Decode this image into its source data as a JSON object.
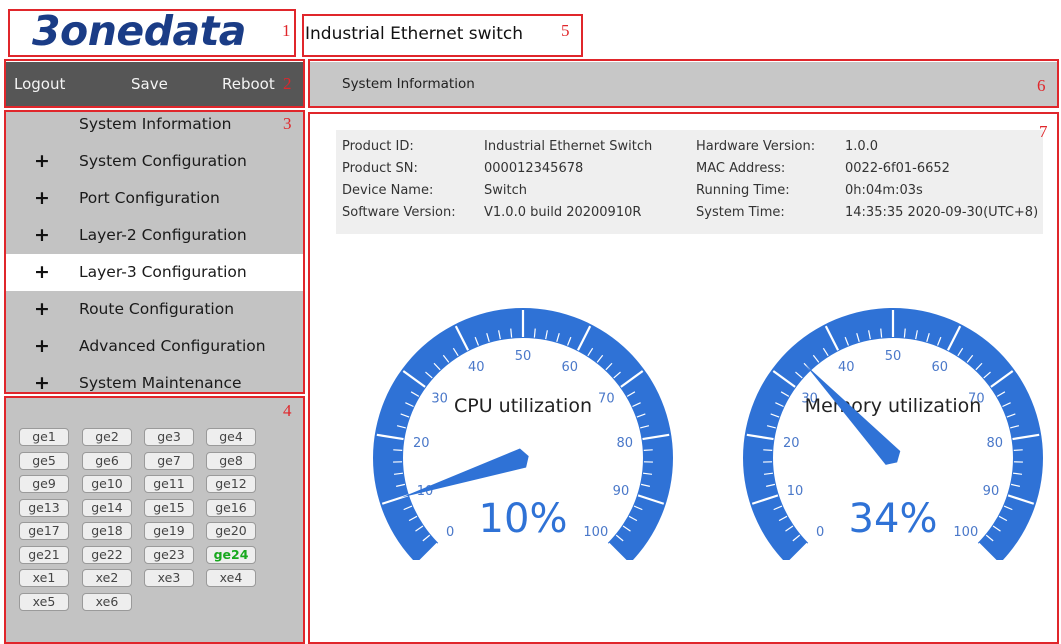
{
  "header": {
    "logo_text": "3onedata",
    "device_title": "Industrial Ethernet switch"
  },
  "topbar": {
    "logout": "Logout",
    "save": "Save",
    "reboot": "Reboot"
  },
  "breadcrumb": "System Information",
  "menu": [
    {
      "label": "System Information",
      "plus": false,
      "active": false
    },
    {
      "label": "System Configuration",
      "plus": true,
      "active": false
    },
    {
      "label": "Port Configuration",
      "plus": true,
      "active": false
    },
    {
      "label": "Layer-2 Configuration",
      "plus": true,
      "active": false
    },
    {
      "label": "Layer-3 Configuration",
      "plus": true,
      "active": true
    },
    {
      "label": "Route Configuration",
      "plus": true,
      "active": false
    },
    {
      "label": "Advanced Configuration",
      "plus": true,
      "active": false
    },
    {
      "label": "System Maintenance",
      "plus": true,
      "active": false
    }
  ],
  "plus_glyph": "+",
  "ports": [
    {
      "name": "ge1",
      "up": false
    },
    {
      "name": "ge2",
      "up": false
    },
    {
      "name": "ge3",
      "up": false
    },
    {
      "name": "ge4",
      "up": false
    },
    {
      "name": "ge5",
      "up": false
    },
    {
      "name": "ge6",
      "up": false
    },
    {
      "name": "ge7",
      "up": false
    },
    {
      "name": "ge8",
      "up": false
    },
    {
      "name": "ge9",
      "up": false
    },
    {
      "name": "ge10",
      "up": false
    },
    {
      "name": "ge11",
      "up": false
    },
    {
      "name": "ge12",
      "up": false
    },
    {
      "name": "ge13",
      "up": false
    },
    {
      "name": "ge14",
      "up": false
    },
    {
      "name": "ge15",
      "up": false
    },
    {
      "name": "ge16",
      "up": false
    },
    {
      "name": "ge17",
      "up": false
    },
    {
      "name": "ge18",
      "up": false
    },
    {
      "name": "ge19",
      "up": false
    },
    {
      "name": "ge20",
      "up": false
    },
    {
      "name": "ge21",
      "up": false
    },
    {
      "name": "ge22",
      "up": false
    },
    {
      "name": "ge23",
      "up": false
    },
    {
      "name": "ge24",
      "up": true
    },
    {
      "name": "xe1",
      "up": false
    },
    {
      "name": "xe2",
      "up": false
    },
    {
      "name": "xe3",
      "up": false
    },
    {
      "name": "xe4",
      "up": false
    },
    {
      "name": "xe5",
      "up": false
    },
    {
      "name": "xe6",
      "up": false
    }
  ],
  "info": [
    {
      "k1": "Product ID:",
      "v1": "Industrial Ethernet Switch",
      "k2": "Hardware Version:",
      "v2": "1.0.0"
    },
    {
      "k1": "Product SN:",
      "v1": "000012345678",
      "k2": "MAC Address:",
      "v2": "0022-6f01-6652"
    },
    {
      "k1": "Device Name:",
      "v1": "Switch",
      "k2": "Running Time:",
      "v2": "0h:04m:03s"
    },
    {
      "k1": "Software Version:",
      "v1": "V1.0.0 build 20200910R",
      "k2": "System Time:",
      "v2": "14:35:35 2020-09-30(UTC+8)"
    }
  ],
  "gauges": [
    {
      "title": "CPU utilization",
      "value": 10,
      "display": "10%"
    },
    {
      "title": "Memory utilization",
      "value": 34,
      "display": "34%"
    }
  ],
  "gauge_ticks": [
    "0",
    "10",
    "20",
    "30",
    "40",
    "50",
    "60",
    "70",
    "80",
    "90",
    "100"
  ],
  "callouts": [
    "1",
    "2",
    "3",
    "4",
    "5",
    "6",
    "7"
  ],
  "colors": {
    "annotation_red": "#e0262b",
    "gauge_blue": "#2f72d6",
    "logo_blue": "#1a3c86",
    "port_up_green": "#18a81e",
    "menu_bg": "#c3c3c3",
    "topbar_bg": "#565656"
  }
}
